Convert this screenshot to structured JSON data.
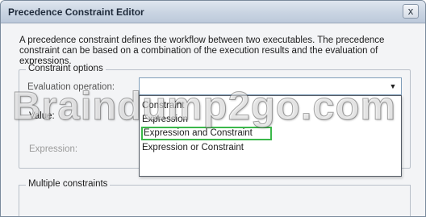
{
  "window": {
    "title": "Precedence Constraint Editor",
    "close_glyph": "x"
  },
  "description": "A precedence constraint defines the workflow between two executables. The precedence constraint can be based on a combination of the execution results and the evaluation of expressions.",
  "constraint_options": {
    "group_label": "Constraint options",
    "evaluation_label": "Evaluation operation:",
    "value_label": "Value:",
    "expression_label": "Expression:",
    "combo_arrow_icon": "chevron-down-icon",
    "dropdown_items": [
      "Constraint",
      "Expression",
      "Expression and Constraint",
      "Expression or Constraint"
    ],
    "highlighted_item": "Expression and Constraint",
    "highlight_color": "#3bb84a"
  },
  "multiple_constraints": {
    "group_label": "Multiple constraints"
  },
  "watermark": "Braindump2go.com"
}
